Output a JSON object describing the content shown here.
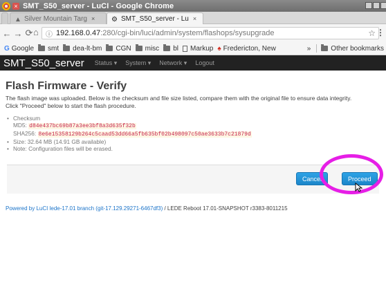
{
  "window": {
    "title": "SMT_S50_server - LuCI - Google Chrome"
  },
  "tabs": [
    {
      "label": "Silver Mountain Targ",
      "active": false
    },
    {
      "label": "SMT_S50_server - Lu",
      "active": true
    }
  ],
  "address": {
    "host": "192.168.0.47",
    "path": ":280/cgi-bin/luci/admin/system/flashops/sysupgrade"
  },
  "bookmarks": {
    "items": [
      "Google",
      "smt",
      "dea-lt-bm",
      "CGN",
      "misc",
      "bl",
      "Markup",
      "Fredericton, New"
    ],
    "overflow": "»",
    "other": "Other bookmarks"
  },
  "luci": {
    "brand": "SMT_S50_server",
    "menu": [
      "Status ▾",
      "System ▾",
      "Network ▾",
      "Logout"
    ]
  },
  "page": {
    "title": "Flash Firmware - Verify",
    "desc_line1": "The flash image was uploaded. Below is the checksum and file size listed, compare them with the original file to ensure data integrity.",
    "desc_line2": "Click \"Proceed\" below to start the flash procedure.",
    "checksum_label": "Checksum",
    "md5_label": "MD5:",
    "md5": "d84e437bc69b87a3ee3bf8a3d635f32b",
    "sha_label": "SHA256:",
    "sha256": "8e6e15358129b264c5caad53dd66a5fb635bf02b498097c50ae3633b7c21879d",
    "size": "Size: 32.64 MB (14.91 GB available)",
    "note": "Note: Configuration files will be erased."
  },
  "actions": {
    "cancel": "Cancel",
    "proceed": "Proceed"
  },
  "footer": {
    "link": "Powered by LuCI lede-17.01 branch (git-17.129.29271-6467df3)",
    "rest": " / LEDE Reboot 17.01-SNAPSHOT r3383-8011215"
  },
  "colors": {
    "accent": "#1d86c9",
    "highlight": "#e61ee6",
    "header": "#222222"
  }
}
